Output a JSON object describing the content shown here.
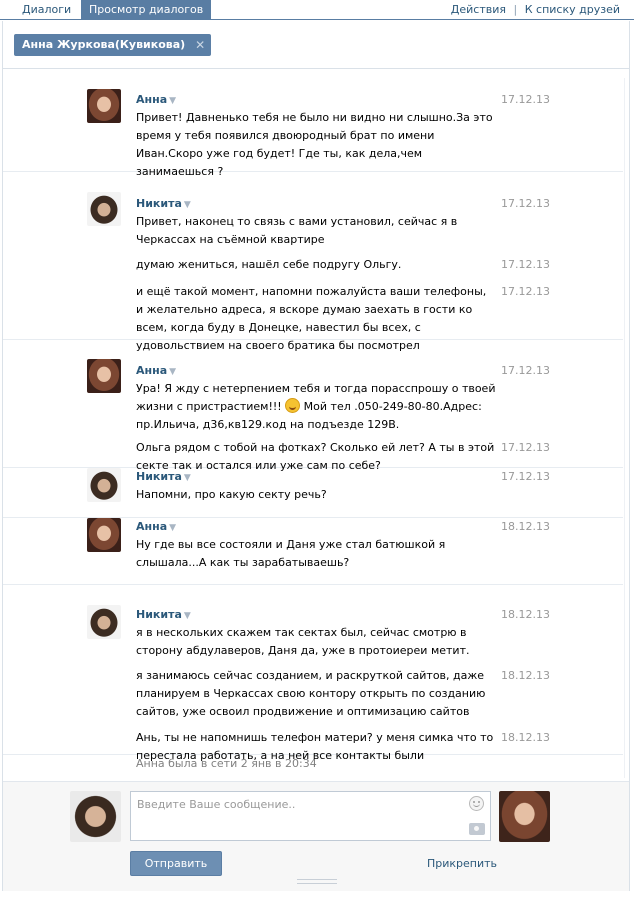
{
  "tabs": [
    {
      "label": "Диалоги",
      "active": false
    },
    {
      "label": "Просмотр диалогов",
      "active": true
    }
  ],
  "top_links": {
    "actions": "Действия",
    "separator": "|",
    "friends": "К списку друзей"
  },
  "recipient": {
    "name": "Анна Журкова(Кувикова)",
    "remove_icon": "close-icon"
  },
  "groups": [
    {
      "sender": "Анна",
      "avatar": "anna",
      "messages": [
        {
          "text": "Привет! Давненько тебя не было ни видно ни слышно.За это время у тебя появился двоюродный брат по имени Иван.Скоро уже год будет! Где ты, как дела,чем занимаешься ?",
          "time": "17.12.13"
        }
      ]
    },
    {
      "sender": "Никита",
      "avatar": "nikita",
      "messages": [
        {
          "text": "Привет, наконец то связь с вами установил, сейчас я в Черкассах на съёмной квартире",
          "time": "17.12.13"
        },
        {
          "text": "думаю жениться, нашёл себе подругу Ольгу.",
          "time": "17.12.13"
        },
        {
          "text": "и ещё такой момент, напомни пожалуйста ваши телефоны, и желательно адреса, я вскоре думаю заехать в гости ко всем, когда буду в Донецке, навестил бы всех, с удовольствием на своего братика бы посмотрел",
          "time": "17.12.13"
        }
      ]
    },
    {
      "sender": "Анна",
      "avatar": "anna",
      "messages": [
        {
          "text_before": "Ура! Я жду с нетерпением тебя и тогда порасспрошу о твоей жизни с пристрастием!!! ",
          "text_after": " Мой тел .050-249-80-80.Адрес: пр.Ильича, д36,кв129.код на подъезде 129В.",
          "emoji": "smile-emoji",
          "time": "17.12.13"
        },
        {
          "text": "Ольга рядом с тобой на фотках? Сколько ей лет? А ты в этой секте так и остался или уже сам по себе?",
          "time": "17.12.13"
        }
      ]
    },
    {
      "sender": "Никита",
      "avatar": "nikita",
      "messages": [
        {
          "text": "Напомни, про какую секту речь?",
          "time": "17.12.13"
        }
      ]
    },
    {
      "sender": "Анна",
      "avatar": "anna",
      "messages": [
        {
          "text": "Ну где вы все состояли и Даня уже стал батюшкой я слышала...А как ты зарабатываешь?",
          "time": "18.12.13"
        }
      ]
    },
    {
      "sender": "Никита",
      "avatar": "nikita",
      "messages": [
        {
          "text": "я в нескольких скажем так сектах был, сейчас смотрю в сторону абдулаверов, Даня да, уже в протоиереи метит.",
          "time": "18.12.13"
        },
        {
          "text": "я занимаюсь сейчас созданием, и раскруткой сайтов, даже планируем в Черкассах свою контору открыть по созданию сайтов, уже освоил продвижение и оптимизацию сайтов",
          "time": "18.12.13"
        },
        {
          "text": "Ань, ты не напомнишь телефон матери? у меня симка что то перестала работать, а на ней все контакты были",
          "time": "18.12.13"
        }
      ]
    }
  ],
  "status": "Анна была в сети 2 янв в 20:34",
  "composer": {
    "placeholder": "Введите Ваше сообщение..",
    "send_label": "Отправить",
    "attach_label": "Прикрепить",
    "emoji_icon": "smile-icon",
    "photo_icon": "camera-icon"
  },
  "colors": {
    "accent": "#597da3",
    "link": "#2b587a",
    "time": "#999999",
    "chip": "#5b7fa6",
    "send_button": "#6d8fb3"
  }
}
